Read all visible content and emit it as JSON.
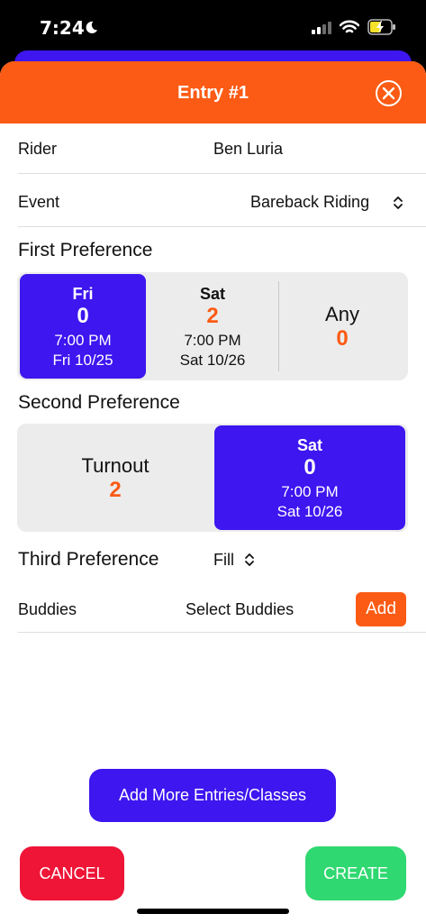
{
  "status_bar": {
    "time": "7:24"
  },
  "header": {
    "title": "Entry #1"
  },
  "rider": {
    "label": "Rider",
    "value": "Ben Luria"
  },
  "event": {
    "label": "Event",
    "value": "Bareback Riding"
  },
  "first_preference": {
    "title": "First Preference",
    "options": [
      {
        "day": "Fri",
        "count": "0",
        "time": "7:00 PM",
        "date": "Fri 10/25",
        "selected": true
      },
      {
        "day": "Sat",
        "count": "2",
        "time": "7:00 PM",
        "date": "Sat 10/26",
        "selected": false
      },
      {
        "day": "Any",
        "count": "0",
        "selected": false
      }
    ]
  },
  "second_preference": {
    "title": "Second Preference",
    "options": [
      {
        "day": "Turnout",
        "count": "2",
        "selected": false
      },
      {
        "day": "Sat",
        "count": "0",
        "time": "7:00 PM",
        "date": "Sat 10/26",
        "selected": true
      }
    ]
  },
  "third_preference": {
    "title": "Third Preference",
    "value": "Fill"
  },
  "buddies": {
    "label": "Buddies",
    "value": "Select Buddies",
    "add_label": "Add"
  },
  "actions": {
    "add_more_label": "Add More Entries/Classes",
    "cancel_label": "CANCEL",
    "create_label": "CREATE"
  },
  "colors": {
    "accent_orange": "#fb5b14",
    "accent_blue": "#3d16f0",
    "cancel_red": "#ee1537",
    "create_green": "#2fd870"
  }
}
